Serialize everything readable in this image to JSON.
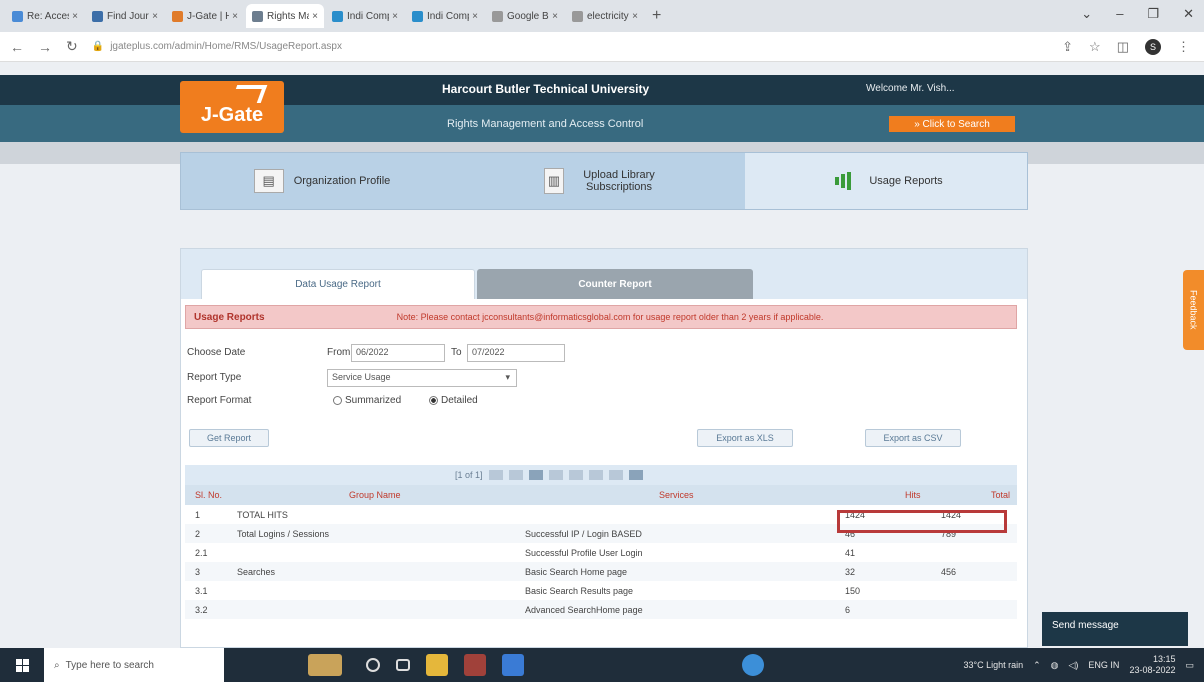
{
  "browser": {
    "tabs": [
      {
        "title": "Re: Access",
        "color": "#4a8bd6",
        "active": false
      },
      {
        "title": "Find Journal",
        "color": "#3c6ea8",
        "active": false
      },
      {
        "title": "J-Gate | Home",
        "color": "#e07b2a",
        "active": false
      },
      {
        "title": "Rights Manage",
        "color": "#6d7e8f",
        "active": true
      },
      {
        "title": "Indi Compus",
        "color": "#2a8ecb",
        "active": false
      },
      {
        "title": "Indi Compus",
        "color": "#2a8ecb",
        "active": false
      },
      {
        "title": "Google BPS",
        "color": "#999999",
        "active": false
      },
      {
        "title": "electricity c",
        "color": "#999999",
        "active": false
      }
    ],
    "new_tab": "+",
    "url": "jgateplus.com/admin/Home/RMS/UsageReport.aspx",
    "profile_initial": "S"
  },
  "site": {
    "logo_text": "J-Gate",
    "university": "Harcourt Butler Technical University",
    "welcome": "Welcome Mr. Vish...",
    "subtitle": "Rights Management and Access Control",
    "search_button": "» Click to Search"
  },
  "nav_cards": [
    {
      "label": "Organization Profile",
      "icon": "org-profile-icon"
    },
    {
      "label": "Upload Library Subscriptions",
      "icon": "upload-doc-icon"
    },
    {
      "label": "Usage Reports",
      "icon": "chart-icon"
    }
  ],
  "report": {
    "tabs": [
      "Data Usage Report",
      "Counter Report"
    ],
    "header_title": "Usage Reports",
    "header_note": "Note: Please contact jcconsultants@informaticsglobal.com for usage report older than 2 years if applicable.",
    "choose_date_label": "Choose Date",
    "from_label": "From",
    "from_value": "06/2022",
    "to_label": "To",
    "to_value": "07/2022",
    "report_type_label": "Report Type",
    "report_type_value": "Service Usage",
    "report_format_label": "Report Format",
    "format_summarized": "Summarized",
    "format_detailed": "Detailed",
    "get_report": "Get Report",
    "export_xls": "Export as XLS",
    "export_csv": "Export as CSV",
    "pager_text": "[1 of 1]",
    "columns": [
      "Sl. No.",
      "Group Name",
      "Services",
      "Hits",
      "Total"
    ],
    "rows": [
      {
        "sl": "1",
        "group": "TOTAL HITS",
        "service": "",
        "hits": "1424",
        "total": "1424"
      },
      {
        "sl": "2",
        "group": "Total Logins / Sessions",
        "service": "Successful IP / Login BASED",
        "hits": "46",
        "total": "789"
      },
      {
        "sl": "2.1",
        "group": "",
        "service": "Successful Profile User Login",
        "hits": "41",
        "total": ""
      },
      {
        "sl": "3",
        "group": "Searches",
        "service": "Basic Search Home page",
        "hits": "32",
        "total": "456"
      },
      {
        "sl": "3.1",
        "group": "",
        "service": "Basic Search Results page",
        "hits": "150",
        "total": ""
      },
      {
        "sl": "3.2",
        "group": "",
        "service": "Advanced SearchHome page",
        "hits": "6",
        "total": ""
      }
    ]
  },
  "widgets": {
    "feedback": "Feedback",
    "send_message": "Send message"
  },
  "taskbar": {
    "search_placeholder": "Type here to search",
    "weather": "33°C  Light rain",
    "lang": "ENG IN",
    "time": "13:15",
    "date": "23-08-2022"
  }
}
